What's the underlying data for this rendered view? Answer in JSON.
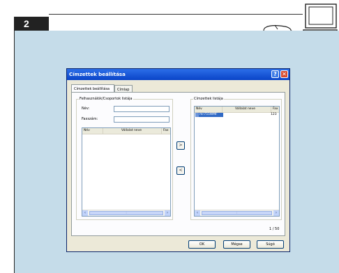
{
  "step": {
    "number": "2"
  },
  "icons": {
    "computer": "computer-icon",
    "mouse": "mouse-icon"
  },
  "dialog": {
    "title": "Címzettek beállítása",
    "help_button": "?",
    "close_button": "✕",
    "tabs": [
      {
        "label": "Címzettek beállítása",
        "active": true
      },
      {
        "label": "Címlap",
        "active": false
      }
    ],
    "left_group": {
      "legend": "Felhasználók/Csoportok listája",
      "name_label": "Név:",
      "name_value": "",
      "fax_label": "Faxszám:",
      "fax_value": "",
      "columns": [
        "Név",
        "Vállalat neve",
        "Fax"
      ],
      "rows": []
    },
    "add_button": ">",
    "remove_button": "<",
    "right_group": {
      "legend": "Címzettek listája",
      "columns": [
        "Név",
        "Vállalat neve",
        "Fax"
      ],
      "rows": [
        {
          "name": "mr755WMF",
          "company": "",
          "fax": "123"
        }
      ],
      "count": "1 / 50"
    },
    "buttons": {
      "ok": "OK",
      "cancel": "Mégse",
      "help": "Súgó"
    }
  },
  "colors": {
    "panel_background": "#c5dce9",
    "titlebar": "#0a44c8",
    "selection": "#316ac5",
    "close": "#d84a2c"
  }
}
